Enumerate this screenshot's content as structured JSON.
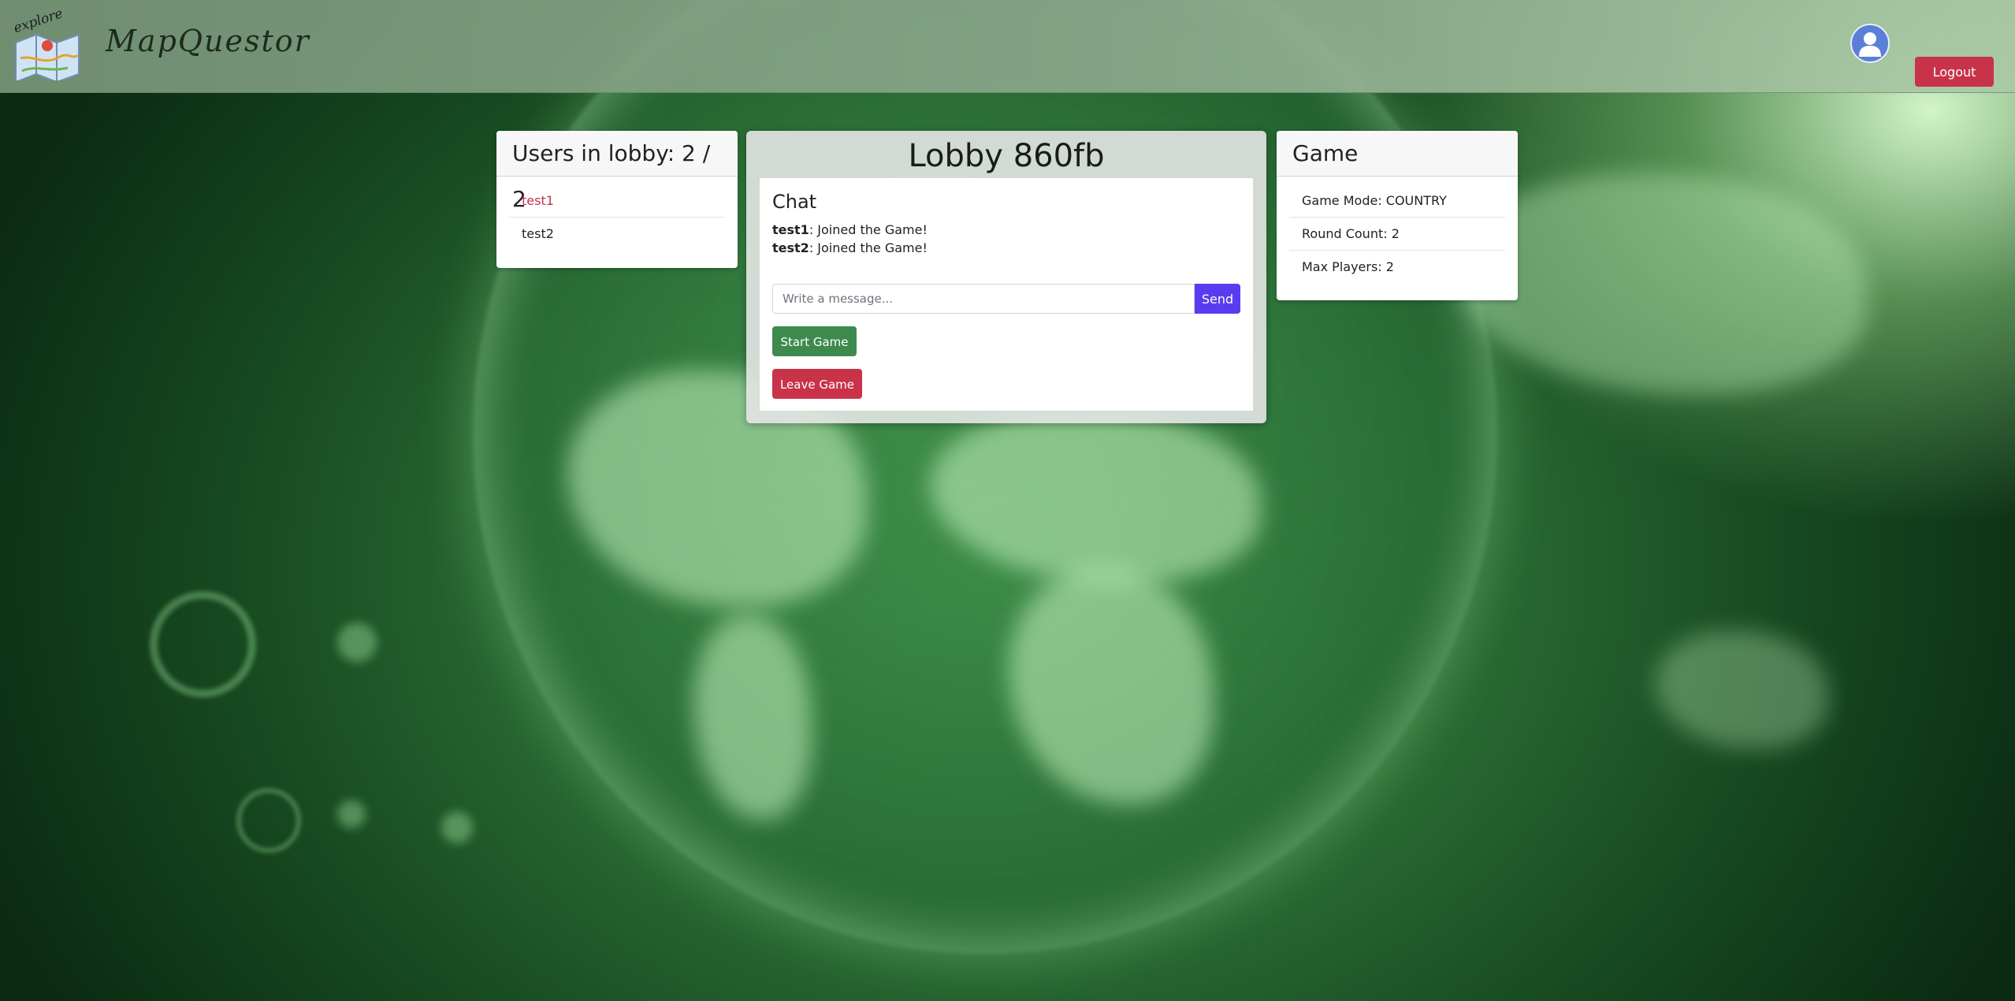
{
  "header": {
    "logo_text": "explore",
    "brand": "MapQuestor",
    "logout_label": "Logout"
  },
  "users_panel": {
    "title": "Users in lobby: 2 / 2",
    "users": [
      "test1",
      "test2"
    ],
    "host_color": "#c8334a"
  },
  "lobby": {
    "title": "Lobby 860fb",
    "chat": {
      "title": "Chat",
      "messages": [
        {
          "user": "test1",
          "text": ": Joined the Game!"
        },
        {
          "user": "test2",
          "text": ": Joined the Game!"
        }
      ],
      "input_placeholder": "Write a message...",
      "send_label": "Send"
    },
    "start_label": "Start Game",
    "leave_label": "Leave Game"
  },
  "game_panel": {
    "title": "Game",
    "settings": [
      "Game Mode: COUNTRY",
      "Round Count: 2",
      "Max Players: 2"
    ]
  },
  "colors": {
    "send": "#5a3cf0",
    "start": "#3e8a4e",
    "danger": "#c8334a"
  }
}
